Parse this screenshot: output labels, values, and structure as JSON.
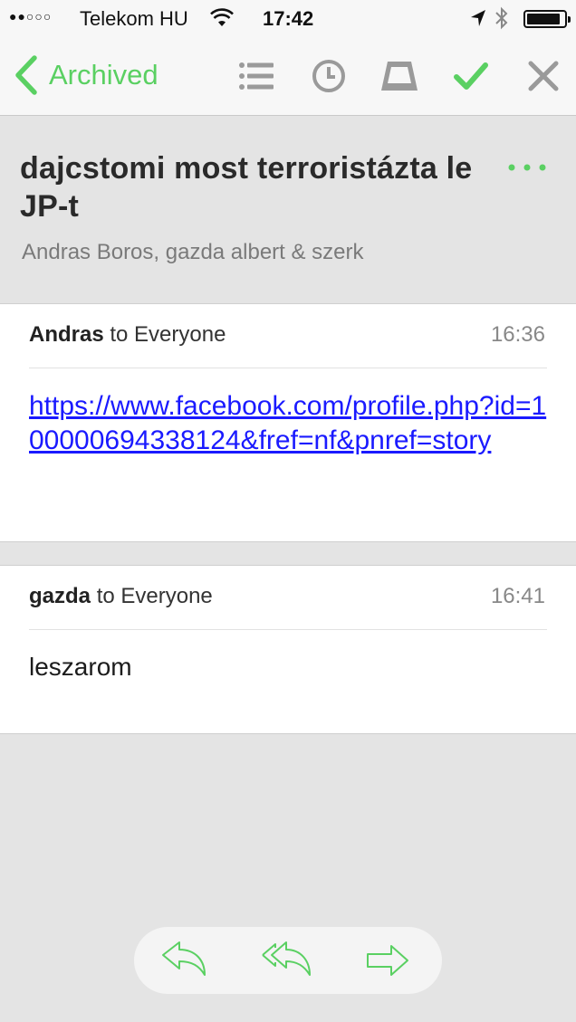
{
  "status_bar": {
    "signal": "●●○○○",
    "carrier": "Telekom HU",
    "time": "17:42",
    "battery_level": 0.9
  },
  "nav": {
    "back_label": "Archived",
    "icons": [
      "list-icon",
      "clock-icon",
      "inbox-tray-icon",
      "checkmark-icon",
      "close-icon"
    ],
    "accent_color": "#5ad062",
    "icon_gray": "#9a9a9a"
  },
  "thread": {
    "title": "dajcstomi most terroristázta le JP-t",
    "participants": "Andras Boros, gazda albert & szerk"
  },
  "messages": [
    {
      "sender": "Andras",
      "recipient_text": "to Everyone",
      "time": "16:36",
      "link": "https://www.facebook.com/profile.php?id=100000694338124&fref=nf&pnref=story"
    },
    {
      "sender": "gazda",
      "recipient_text": "to Everyone",
      "time": "16:41",
      "body": "leszarom"
    }
  ],
  "toolbar": {
    "buttons": [
      "reply-icon",
      "reply-all-icon",
      "forward-icon"
    ]
  }
}
